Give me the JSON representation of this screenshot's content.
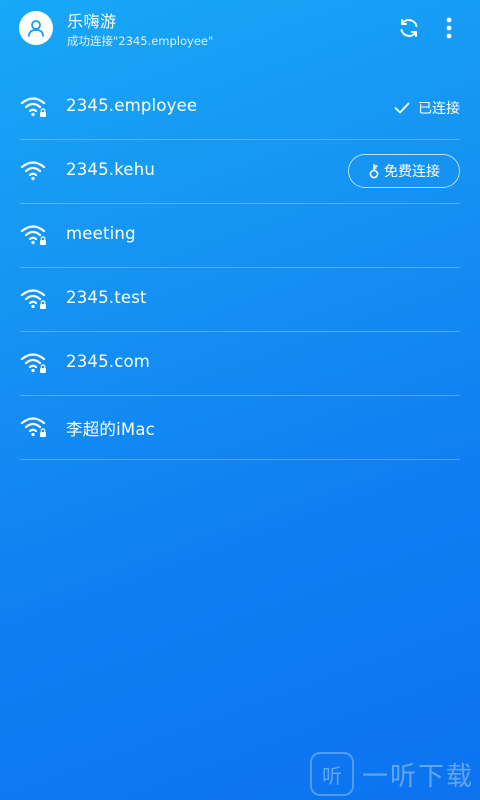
{
  "header": {
    "title": "乐嗨游",
    "status": "成功连接\"2345.employee\"",
    "icons": {
      "avatar": "user-avatar-icon",
      "refresh": "refresh-icon",
      "more": "more-vertical-icon"
    }
  },
  "networks": [
    {
      "name": "2345.employee",
      "status": "已连接"
    },
    {
      "name": "2345.kehu",
      "action": "免费连接"
    },
    {
      "name": "meeting"
    },
    {
      "name": "2345.test"
    },
    {
      "name": "2345.com"
    },
    {
      "name": "李超的iMac"
    }
  ],
  "watermark": {
    "logo": "听",
    "text": "一听下载"
  },
  "colors": {
    "background_top": "#18a8f6",
    "background_bottom": "#0c73ef",
    "foreground": "#ffffff",
    "avatar_icon": "#1a9cf5"
  }
}
